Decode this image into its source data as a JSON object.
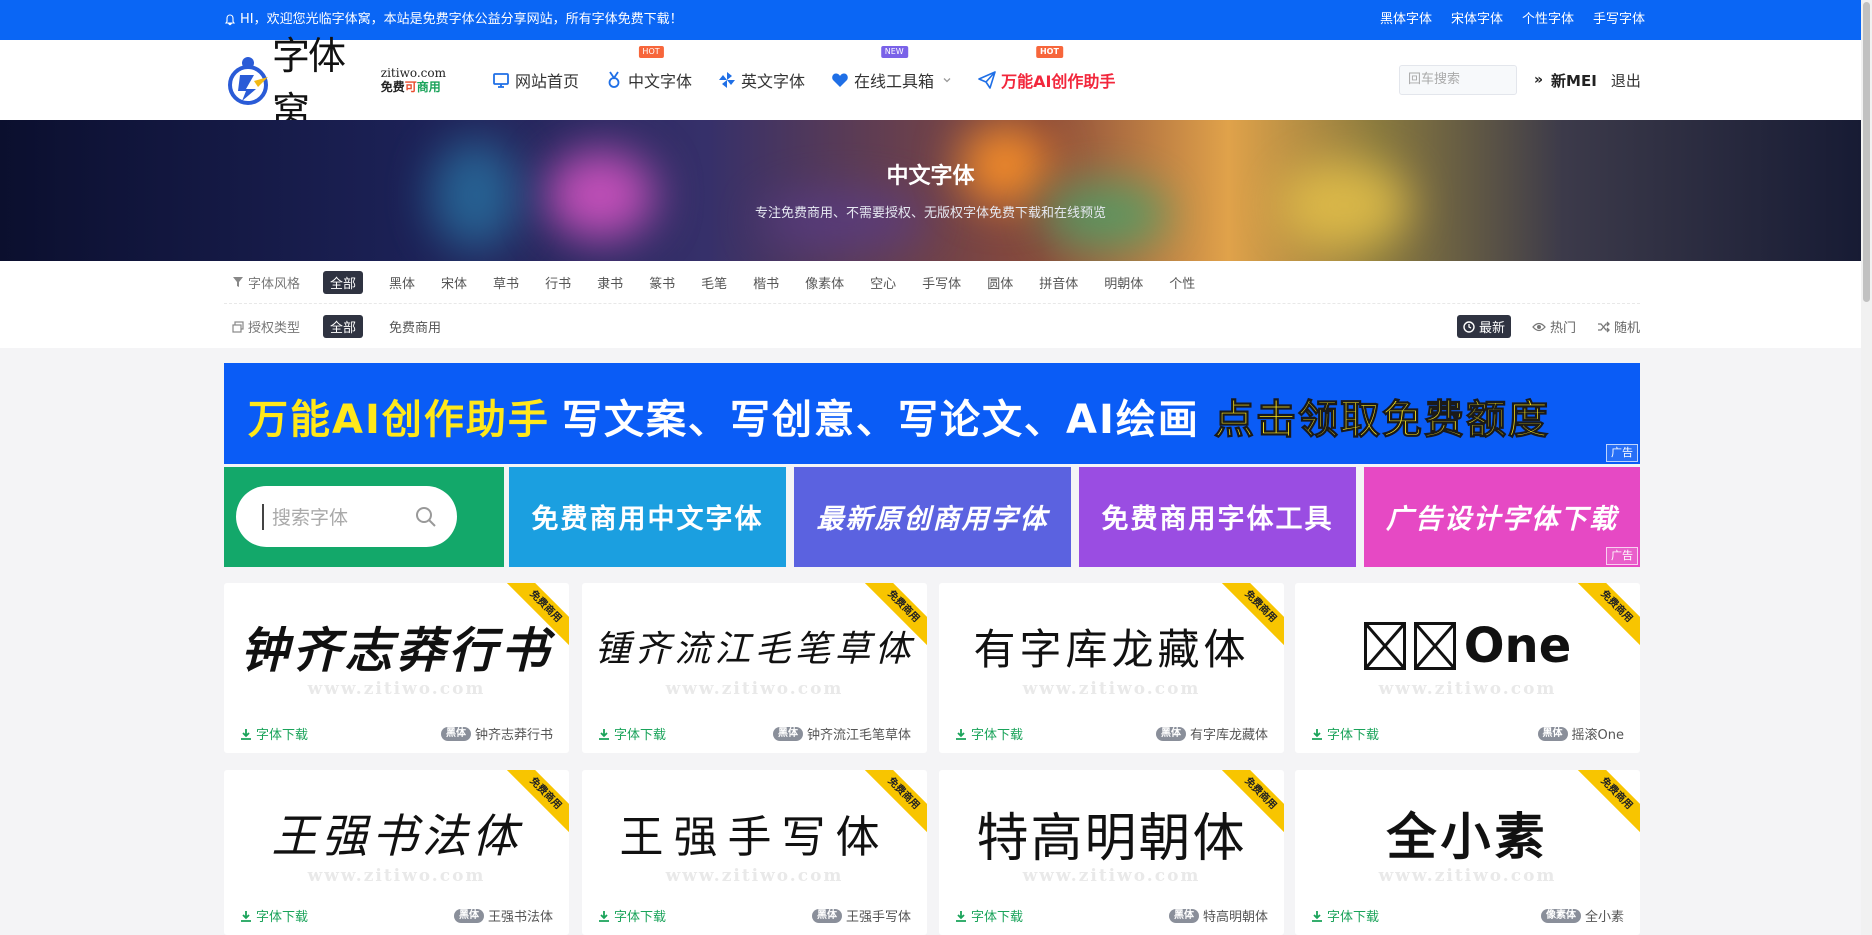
{
  "topbar": {
    "welcome": "HI，欢迎您光临字体窝，本站是免费字体公益分享网站，所有字体免费下载！",
    "links": [
      "黑体字体",
      "宋体字体",
      "个性字体",
      "手写字体"
    ]
  },
  "logo": {
    "name": "字体窝",
    "domain": "zitiwo.com",
    "slogan_1": "免费",
    "slogan_2": "可",
    "slogan_3": "商用"
  },
  "nav": {
    "items": [
      {
        "label": "网站首页",
        "icon": "monitor-icon",
        "badge": ""
      },
      {
        "label": "中文字体",
        "icon": "medal-icon",
        "badge": "HOT"
      },
      {
        "label": "英文字体",
        "icon": "pinwheel-icon",
        "badge": ""
      },
      {
        "label": "在线工具箱",
        "icon": "heart-icon",
        "badge": "NEW"
      },
      {
        "label": "万能AI创作助手",
        "icon": "paper-plane-icon",
        "badge": "HOT"
      }
    ]
  },
  "search_top": {
    "placeholder": "回车搜索"
  },
  "user": {
    "name": "新MEI",
    "logout": "退出"
  },
  "banner": {
    "title": "中文字体",
    "subtitle": "专注免费商用、不需要授权、无版权字体免费下载和在线预览"
  },
  "filters": {
    "style_label": "字体风格",
    "styles": [
      "全部",
      "黑体",
      "宋体",
      "草书",
      "行书",
      "隶书",
      "篆书",
      "毛笔",
      "楷书",
      "像素体",
      "空心",
      "手写体",
      "圆体",
      "拼音体",
      "明朝体",
      "个性"
    ],
    "license_label": "授权类型",
    "licenses": [
      "全部",
      "免费商用"
    ],
    "sorts": [
      "最新",
      "热门",
      "随机"
    ]
  },
  "ad": {
    "text_1": "万能AI创作助手",
    "text_2": "写文案、写创意、写论文、AI绘画",
    "text_3": "点击领取免费额度",
    "tag": "广告"
  },
  "tiles": {
    "search_placeholder": "搜索字体",
    "t1": "免费商用中文字体",
    "t2": "最新原创商用字体",
    "t3": "免费商用字体工具",
    "t4": "广告设计字体下载",
    "tag": "广告"
  },
  "cards": [
    {
      "preview": "钟齐志莽行书",
      "name": "钟齐志莽行书",
      "category": "黑体",
      "ribbon": "免费商用",
      "download": "字体下载",
      "watermark": "www.zitiwo.com"
    },
    {
      "preview": "锺齐流江毛笔草体",
      "name": "钟齐流江毛笔草体",
      "category": "黑体",
      "ribbon": "免费商用",
      "download": "字体下载",
      "watermark": "www.zitiwo.com"
    },
    {
      "preview": "有字库龙藏体",
      "name": "有字库龙藏体",
      "category": "黑体",
      "ribbon": "免费商用",
      "download": "字体下载",
      "watermark": "www.zitiwo.com"
    },
    {
      "preview": "One",
      "name": "摇滚One",
      "category": "黑体",
      "ribbon": "免费商用",
      "download": "字体下载",
      "watermark": "www.zitiwo.com"
    },
    {
      "preview": "王强书法体",
      "name": "王强书法体",
      "category": "黑体",
      "ribbon": "免费商用",
      "download": "字体下载",
      "watermark": "www.zitiwo.com"
    },
    {
      "preview": "王强手写体",
      "name": "王强手写体",
      "category": "黑体",
      "ribbon": "免费商用",
      "download": "字体下载",
      "watermark": "www.zitiwo.com"
    },
    {
      "preview": "特高明朝体",
      "name": "特高明朝体",
      "category": "黑体",
      "ribbon": "免费商用",
      "download": "字体下载",
      "watermark": "www.zitiwo.com"
    },
    {
      "preview": "全小素",
      "name": "全小素",
      "category": "像素体",
      "ribbon": "免费商用",
      "download": "字体下载",
      "watermark": "www.zitiwo.com"
    }
  ],
  "colors": {
    "topbar": "#0a66f5",
    "tile_1": "#13a86a",
    "tile_2": "#1b9fe0",
    "tile_3": "#5b62e0",
    "tile_4": "#9a4de2",
    "tile_5": "#e649c4",
    "ribbon": "#f8c500",
    "download": "#1aa35a"
  }
}
